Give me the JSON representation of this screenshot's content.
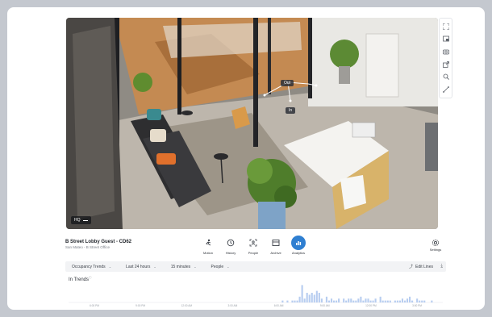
{
  "camera": {
    "quality_badge": "HQ",
    "line_out_label": "Out",
    "line_in_label": "In"
  },
  "toolstrip": {
    "icons": [
      "fullscreen-icon",
      "picture-in-picture-icon",
      "snapshot-icon",
      "share-icon",
      "zoom-icon",
      "line-crossing-icon"
    ]
  },
  "info": {
    "camera_name": "B Street Lobby Guest - CD62",
    "location": "San Mateo - B Street Office"
  },
  "nav": {
    "items": [
      {
        "label": "Motion",
        "icon": "motion-icon"
      },
      {
        "label": "History",
        "icon": "history-icon"
      },
      {
        "label": "People",
        "icon": "people-icon"
      },
      {
        "label": "Archive",
        "icon": "archive-icon"
      },
      {
        "label": "Analytics",
        "icon": "analytics-icon",
        "active": true
      }
    ],
    "settings_label": "Settings"
  },
  "filters": {
    "trend_type": "Occupancy Trends",
    "time_range": "Last 24 hours",
    "interval": "15 minutes",
    "object": "People",
    "edit_lines": "Edit Lines"
  },
  "trends": {
    "title": "In Trends"
  },
  "colors": {
    "accent": "#2f7fd1",
    "bar": "#b7cdf0"
  },
  "chart_data": {
    "type": "bar",
    "x_tick_labels": [
      "6:00 PM",
      "9:00 PM",
      "12:00 AM",
      "3:00 AM",
      "6:00 AM",
      "9:00 AM",
      "12:00 PM",
      "3:00 PM"
    ],
    "values": [
      0,
      0,
      0,
      0,
      0,
      0,
      0,
      0,
      0,
      0,
      0,
      0,
      0,
      0,
      0,
      0,
      0,
      0,
      0,
      0,
      0,
      0,
      0,
      0,
      0,
      0,
      0,
      0,
      0,
      0,
      0,
      0,
      0,
      0,
      0,
      0,
      0,
      0,
      0,
      0,
      0,
      0,
      0,
      0,
      0,
      0,
      0,
      0,
      0,
      0,
      0,
      0,
      0,
      0,
      0,
      0,
      0,
      0,
      0,
      0,
      0,
      0,
      0,
      0,
      0,
      0,
      0,
      0,
      0,
      0,
      0,
      0,
      0,
      0,
      0,
      0,
      0,
      0,
      0,
      0,
      0,
      0,
      0,
      0,
      0,
      0,
      0,
      1,
      0,
      1,
      0,
      1,
      1,
      1,
      3,
      9,
      2,
      5,
      4,
      5,
      4,
      6,
      5,
      2,
      0,
      3,
      1,
      2,
      1,
      1,
      2,
      0,
      2,
      1,
      2,
      2,
      1,
      1,
      2,
      3,
      1,
      2,
      2,
      1,
      1,
      2,
      0,
      3,
      1,
      1,
      1,
      1,
      0,
      1,
      1,
      1,
      2,
      1,
      2,
      3,
      1,
      0,
      2,
      1,
      1,
      1,
      0,
      0,
      1,
      0,
      0,
      0,
      0
    ],
    "ylim": [
      0,
      10
    ]
  }
}
